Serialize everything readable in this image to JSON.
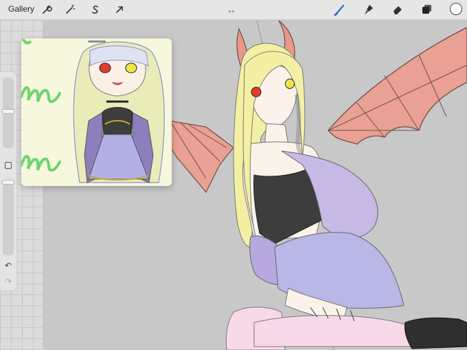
{
  "topbar": {
    "gallery_label": "Gallery",
    "left_tools": [
      "wrench-icon",
      "magic-wand-icon",
      "selection-s-icon",
      "arrow-transform-icon"
    ],
    "right_tools": [
      "brush-icon",
      "smudge-icon",
      "eraser-icon",
      "layers-icon"
    ],
    "color_swatch": "#ffffff",
    "accent_color": "#2f6fd6"
  },
  "sidebar": {
    "brush_size_level": 0.52,
    "opacity_level": 0.05,
    "undo_icon": "undo-icon",
    "redo_icon": "redo-icon"
  },
  "reference_window": {
    "background": "#f6f7dd",
    "script_text_color": "#6dd36d"
  },
  "canvas": {
    "background": "#c8c8c8",
    "wing_color": "#e8a193",
    "hair_color": "#f3f0a4",
    "top_color": "#3d3d3d",
    "skirt_color": "#b9b7e6",
    "jacket_color": "#c7b9e6",
    "sock_color": "#f8d9ea"
  }
}
